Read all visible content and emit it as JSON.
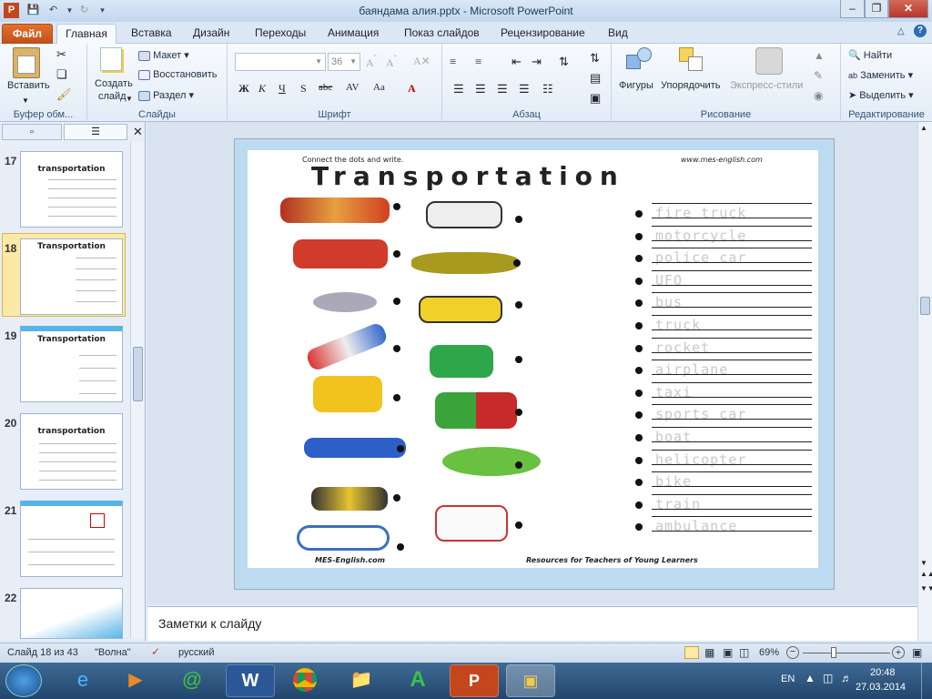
{
  "window": {
    "title": "баяндама алия.pptx - Microsoft PowerPoint"
  },
  "tabs": {
    "file": "Файл",
    "items": [
      "Главная",
      "Вставка",
      "Дизайн",
      "Переходы",
      "Анимация",
      "Показ слайдов",
      "Рецензирование",
      "Вид"
    ]
  },
  "ribbon": {
    "clipboard": {
      "paste": "Вставить",
      "label": "Буфер обм..."
    },
    "slides": {
      "new_slide_1": "Создать",
      "new_slide_2": "слайд",
      "layout": "Макет",
      "reset": "Восстановить",
      "section": "Раздел",
      "label": "Слайды"
    },
    "font": {
      "size": "36",
      "label": "Шрифт"
    },
    "paragraph": {
      "label": "Абзац"
    },
    "drawing": {
      "shapes": "Фигуры",
      "arrange": "Упорядочить",
      "quick_styles": "Экспресс-стили",
      "label": "Рисование"
    },
    "editing": {
      "find": "Найти",
      "replace": "Заменить",
      "select": "Выделить",
      "label": "Редактирование"
    }
  },
  "thumbnails": [
    {
      "num": "17",
      "title": "transportation"
    },
    {
      "num": "18",
      "title": "Transportation"
    },
    {
      "num": "19",
      "title": "Transportation"
    },
    {
      "num": "20",
      "title": "transportation"
    },
    {
      "num": "21",
      "title": ""
    },
    {
      "num": "22",
      "title": ""
    }
  ],
  "slide": {
    "instruction": "Connect the dots and write.",
    "url_top": "www.mes-english.com",
    "title": "Transportation",
    "footer_left": "MES-English.com",
    "footer_right": "Resources for Teachers of Young Learners",
    "words": [
      "fire truck",
      "motorcycle",
      "police car",
      "UFO",
      "bus",
      "truck",
      "rocket",
      "airplane",
      "taxi",
      "sports car",
      "boat",
      "helicopter",
      "bike",
      "train",
      "ambulance"
    ]
  },
  "notes": {
    "placeholder": "Заметки к слайду"
  },
  "status": {
    "slide_info": "Слайд 18 из 43",
    "theme": "\"Волна\"",
    "language": "русский",
    "zoom": "69%"
  },
  "taskbar": {
    "lang": "EN",
    "time": "20:48",
    "date": "27.03.2014"
  }
}
